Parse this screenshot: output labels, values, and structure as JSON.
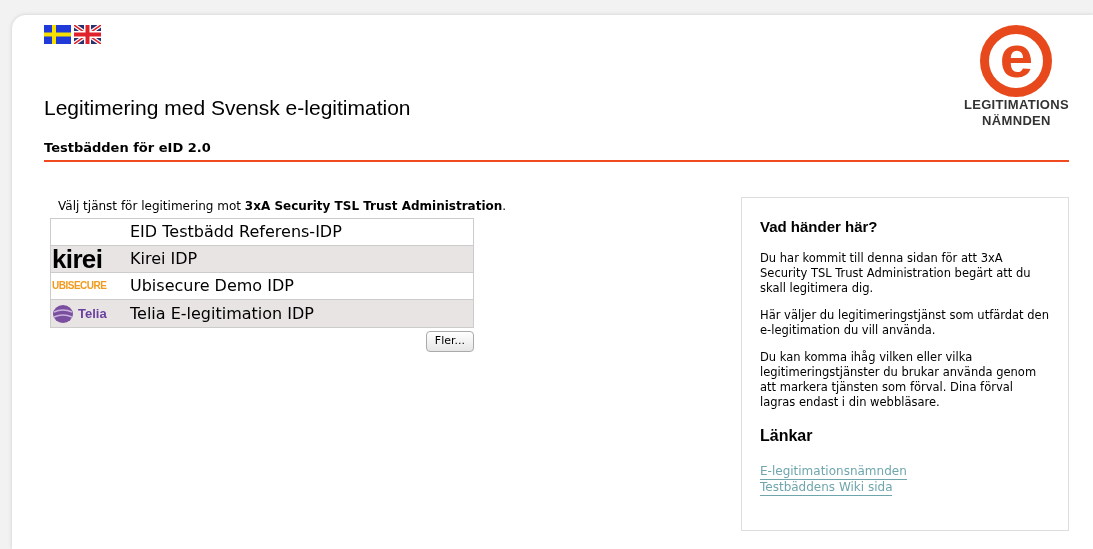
{
  "languages": [
    {
      "kind": "sv"
    },
    {
      "kind": "en"
    }
  ],
  "logo": {
    "mark": "e",
    "lines": [
      "LEGITIMATIONS",
      "NÄMNDEN"
    ]
  },
  "title": "Legitimering med Svensk e-legitimation",
  "subtitle": "Testbädden för eID 2.0",
  "intro": "Välj tjänst för legitimering mot **3xA Security TSL Trust Administration**.",
  "idps": [
    {
      "kind": "none",
      "name": "EID Testbädd Referens-IDP"
    },
    {
      "kind": "kirei",
      "logo": "kirei",
      "name": "Kirei IDP"
    },
    {
      "kind": "ubisecure",
      "logo": "UBISECURE",
      "name": "Ubisecure Demo IDP"
    },
    {
      "kind": "telia",
      "logo": "Telia",
      "name": "Telia E-legitimation IDP"
    }
  ],
  "more_button": "Fler...",
  "sidebar": {
    "heading": "Vad händer här?",
    "paragraphs": [
      "Du har kommit till denna sidan för att 3xA Security TSL Trust Administration begärt att du skall legitimera dig.",
      "Här väljer du legitimeringstjänst som utfärdat den e-legitimation du vill använda.",
      "Du kan komma ihåg vilken eller vilka legitimeringstjänster du brukar använda genom att markera tjänsten som förval. Dina förval lagras endast i din webbläsare."
    ],
    "links_heading": "Länkar",
    "links": [
      "E-legitimationsnämnden",
      "Testbäddens Wiki sida"
    ]
  }
}
